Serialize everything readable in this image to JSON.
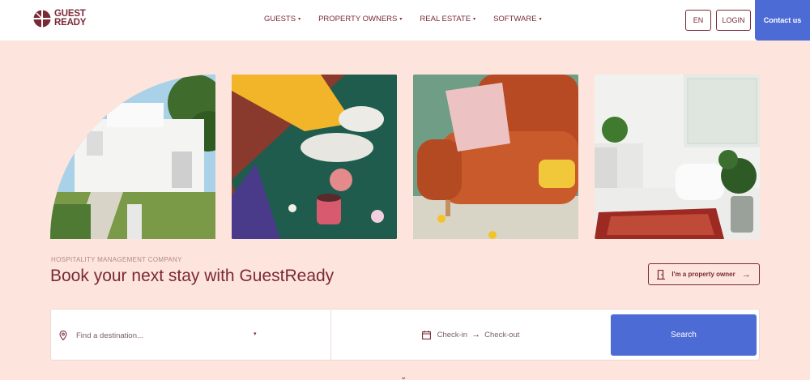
{
  "header": {
    "logo_line1": "GUEST",
    "logo_line2": "READY",
    "nav": [
      {
        "label": "GUESTS",
        "caret": "▾"
      },
      {
        "label": "PROPERTY OWNERS",
        "caret": "▾"
      },
      {
        "label": "REAL ESTATE",
        "caret": "▾"
      },
      {
        "label": "SOFTWARE",
        "caret": "▾"
      }
    ],
    "language_label": "EN",
    "login_label": "LOGIN",
    "contact_label": "Contact us"
  },
  "hero": {
    "eyebrow": "HOSPITALITY MANAGEMENT COMPANY",
    "headline": "Book your next stay with GuestReady",
    "owner_button_label": "I'm a property owner"
  },
  "search": {
    "destination_placeholder": "Find a destination...",
    "checkin_label": "Check-in",
    "checkout_label": "Check-out",
    "search_label": "Search"
  },
  "colors": {
    "brand": "#7a2a36",
    "accent": "#4d6bd4",
    "background": "#fde4dc"
  }
}
